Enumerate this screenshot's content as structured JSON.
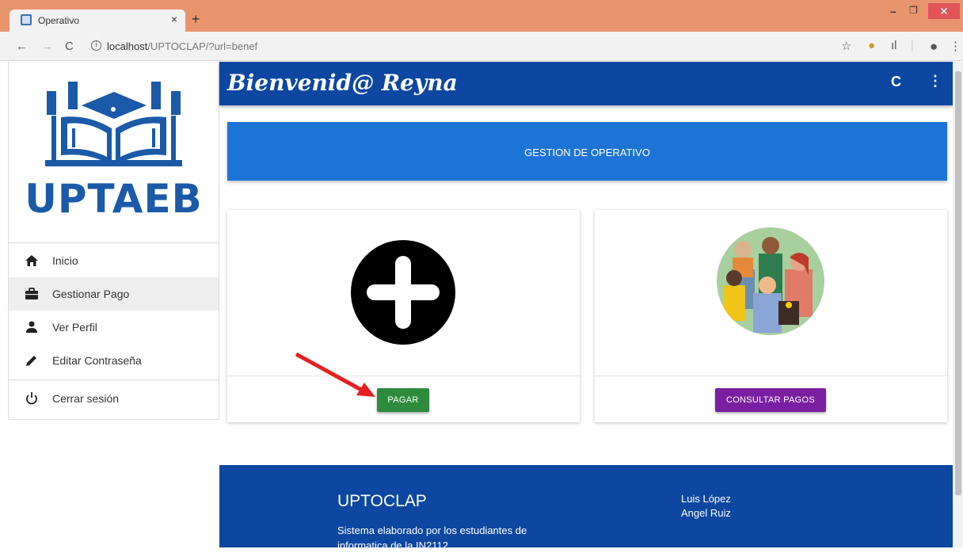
{
  "browser": {
    "tab_title": "Operativo",
    "tab_close": "×",
    "new_tab": "+",
    "url_host": "localhost",
    "url_rest": "/UPTOCLAP/?url=benef"
  },
  "sidebar": {
    "logo_text": "UPTAEB",
    "items": [
      {
        "label": "Inicio",
        "icon": "home-icon"
      },
      {
        "label": "Gestionar Pago",
        "icon": "briefcase-icon"
      },
      {
        "label": "Ver Perfil",
        "icon": "person-icon"
      },
      {
        "label": "Editar Contraseña",
        "icon": "pencil-icon"
      },
      {
        "label": "Cerrar sesión",
        "icon": "power-icon"
      }
    ],
    "active_index": 1
  },
  "topbar": {
    "welcome": "Bienvenid@ Reyna"
  },
  "header": {
    "title": "GESTION DE OPERATIVO"
  },
  "cards": {
    "pay_button": "PAGAR",
    "consult_button": "CONSULTAR PAGOS"
  },
  "footer": {
    "title": "UPTOCLAP",
    "description": "Sistema elaborado por los estudiantes de informatica de la IN2112.",
    "authors": [
      "Luis López",
      "Angel Ruiz"
    ]
  },
  "colors": {
    "topbar": "#0d47a1",
    "header_panel": "#1e73d6",
    "pay_button": "#2e8b3e",
    "consult_button": "#7b1fa2",
    "footer": "#0d47a1"
  }
}
